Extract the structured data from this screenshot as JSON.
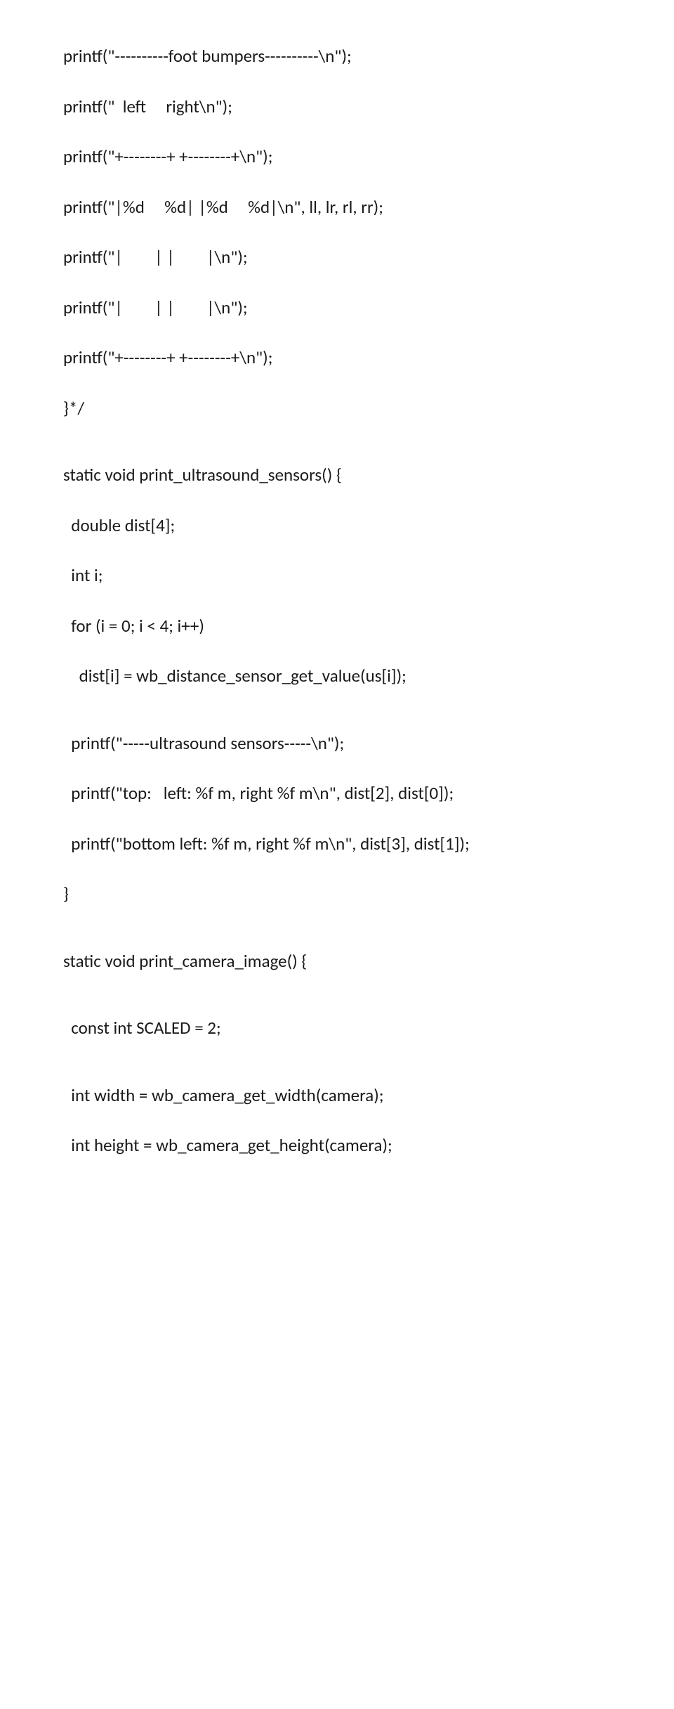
{
  "lines": [
    "printf(\"----------foot bumpers----------\\n\");",
    "",
    "printf(\"  left     right\\n\");",
    "",
    "printf(\"+--------+ +--------+\\n\");",
    "",
    "printf(\"|%d     %d| |%d     %d|\\n\", ll, lr, rl, rr);",
    "",
    "printf(\"|        | |        |\\n\");",
    "",
    "printf(\"|        | |        |\\n\");",
    "",
    "printf(\"+--------+ +--------+\\n\");",
    "",
    "}*/",
    "",
    "",
    "static void print_ultrasound_sensors() {",
    "",
    "  double dist[4];",
    "",
    "  int i;",
    "",
    "  for (i = 0; i < 4; i++)",
    "",
    "    dist[i] = wb_distance_sensor_get_value(us[i]);",
    "",
    "",
    "  printf(\"-----ultrasound sensors-----\\n\");",
    "",
    "  printf(\"top:   left: %f m, right %f m\\n\", dist[2], dist[0]);",
    "",
    "  printf(\"bottom left: %f m, right %f m\\n\", dist[3], dist[1]);",
    "",
    "}",
    "",
    "",
    "static void print_camera_image() {",
    "",
    "",
    "  const int SCALED = 2;",
    "",
    "",
    "  int width = wb_camera_get_width(camera);",
    "",
    "  int height = wb_camera_get_height(camera);"
  ]
}
